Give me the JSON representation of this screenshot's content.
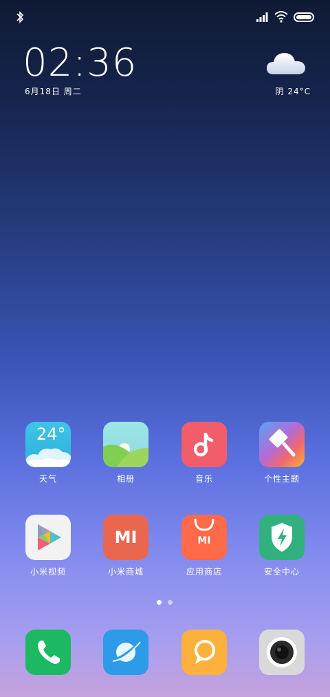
{
  "status": {
    "icons": [
      "bluetooth-icon",
      "signal-icon",
      "wifi-icon",
      "battery-icon"
    ]
  },
  "clock": {
    "time": "02:36",
    "date": "6月18日 周二"
  },
  "weather": {
    "icon": "cloud-icon",
    "text": "阴  24°C"
  },
  "apps": {
    "row1": [
      {
        "label": "天气",
        "icon": "weather-app-icon",
        "badge": "24°"
      },
      {
        "label": "相册",
        "icon": "gallery-app-icon"
      },
      {
        "label": "音乐",
        "icon": "music-app-icon"
      },
      {
        "label": "个性主题",
        "icon": "themes-app-icon"
      }
    ],
    "row2": [
      {
        "label": "小米视频",
        "icon": "video-app-icon"
      },
      {
        "label": "小米商城",
        "icon": "mi-store-app-icon",
        "badge": "MI"
      },
      {
        "label": "应用商店",
        "icon": "app-store-app-icon",
        "badge": "MI"
      },
      {
        "label": "安全中心",
        "icon": "security-app-icon"
      }
    ]
  },
  "pages": {
    "count": 2,
    "current": 1
  },
  "dock": [
    "phone-app-icon",
    "browser-app-icon",
    "messages-app-icon",
    "camera-app-icon"
  ],
  "colors": {
    "weather": "#3cc0e2",
    "music": "#f25d6b",
    "mi_store": "#e9674f",
    "app_store": "#ff6a4a",
    "security": "#33b07f",
    "phone": "#1db862",
    "browser": "#2d9be8",
    "messages": "#fbb13b",
    "camera": "#d9d9d9"
  }
}
